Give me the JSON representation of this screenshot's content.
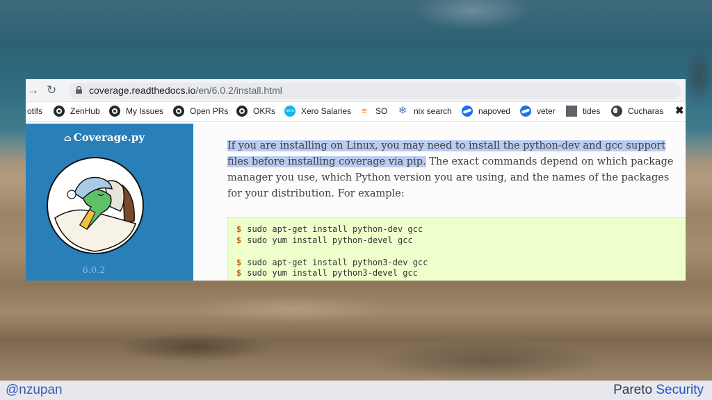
{
  "browser": {
    "back_icon": "arrow-right-icon",
    "reload_icon": "reload-icon",
    "url_host": "coverage.readthedocs.io",
    "url_path": "/en/6.0.2/install.html"
  },
  "bookmarks": [
    {
      "label": "otifs",
      "icon": "none"
    },
    {
      "label": "ZenHub",
      "icon": "github-icon"
    },
    {
      "label": "My Issues",
      "icon": "github-icon"
    },
    {
      "label": "Open PRs",
      "icon": "github-icon"
    },
    {
      "label": "OKRs",
      "icon": "github-icon"
    },
    {
      "label": "Xero Salaries",
      "icon": "xero-icon"
    },
    {
      "label": "SO",
      "icon": "stackoverflow-icon"
    },
    {
      "label": "nix search",
      "icon": "nix-icon"
    },
    {
      "label": "napoved",
      "icon": "swirl-icon"
    },
    {
      "label": "veter",
      "icon": "swirl-icon"
    },
    {
      "label": "tides",
      "icon": "tides-icon"
    },
    {
      "label": "Cucharas",
      "icon": "globe-icon"
    }
  ],
  "sidebar": {
    "title": "Coverage.py",
    "home_icon": "home-icon",
    "version": "6.0.2",
    "background": "#2980b9"
  },
  "content": {
    "highlighted": "If you are installing on Linux, you may need to install the python-dev and gcc support files before installing coverage via pip.",
    "rest": " The exact commands depend on which package manager you use, which Python version you are using, and the names of the packages for your distribution. For example:",
    "prompt": "$",
    "code_lines": [
      "sudo apt-get install python-dev gcc",
      "sudo yum install python-devel gcc",
      "",
      "sudo apt-get install python3-dev gcc",
      "sudo yum install python3-devel gcc"
    ]
  },
  "footer": {
    "handle": "@nzupan",
    "brand_part1": "Pareto ",
    "brand_part2": "Security"
  }
}
